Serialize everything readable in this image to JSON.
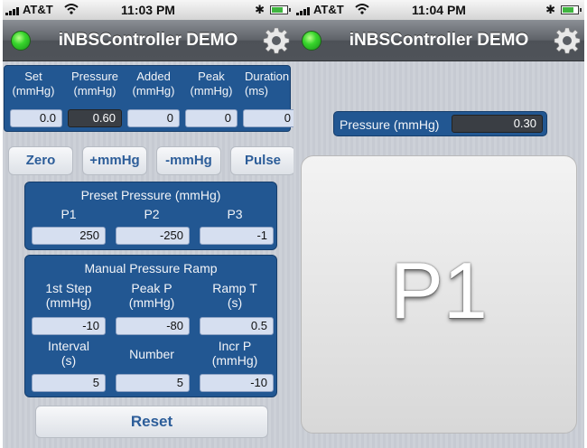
{
  "left": {
    "status": {
      "carrier": "AT&T",
      "time": "11:03 PM"
    },
    "nav": {
      "title": "iNBSController DEMO"
    },
    "readout": {
      "columns": [
        {
          "label": "Set\n(mmHg)",
          "value": "0.0"
        },
        {
          "label": "Pressure\n(mmHg)",
          "value": "0.60"
        },
        {
          "label": "Added\n(mmHg)",
          "value": "0"
        },
        {
          "label": "Peak\n(mmHg)",
          "value": "0"
        },
        {
          "label": "Duration\n(ms)",
          "value": "0"
        }
      ]
    },
    "buttons": {
      "zero": "Zero",
      "plus": "+mmHg",
      "minus": "-mmHg",
      "pulse": "Pulse",
      "reset": "Reset"
    },
    "preset": {
      "title": "Preset Pressure (mmHg)",
      "items": [
        {
          "label": "P1",
          "value": "250"
        },
        {
          "label": "P2",
          "value": "-250"
        },
        {
          "label": "P3",
          "value": "-1"
        }
      ]
    },
    "ramp": {
      "title": "Manual Pressure Ramp",
      "items": [
        {
          "label": "1st Step\n(mmHg)",
          "value": "-10"
        },
        {
          "label": "Peak P\n(mmHg)",
          "value": "-80"
        },
        {
          "label": "Ramp T\n(s)",
          "value": "0.5"
        },
        {
          "label": "Interval\n(s)",
          "value": "5"
        },
        {
          "label": "Number",
          "value": "5"
        },
        {
          "label": "Incr P\n(mmHg)",
          "value": "-10"
        }
      ]
    }
  },
  "right": {
    "status": {
      "carrier": "AT&T",
      "time": "11:04 PM"
    },
    "nav": {
      "title": "iNBSController DEMO"
    },
    "pressure": {
      "label": "Pressure (mmHg)",
      "value": "0.30"
    },
    "pad": {
      "label": "P1"
    }
  },
  "colors": {
    "panel": "#225792",
    "led": "#38d52c",
    "button_text": "#2c5d99"
  },
  "icons": [
    "signal-bars-icon",
    "wifi-icon",
    "bluetooth-icon",
    "battery-icon",
    "status-led-icon",
    "gear-icon"
  ]
}
